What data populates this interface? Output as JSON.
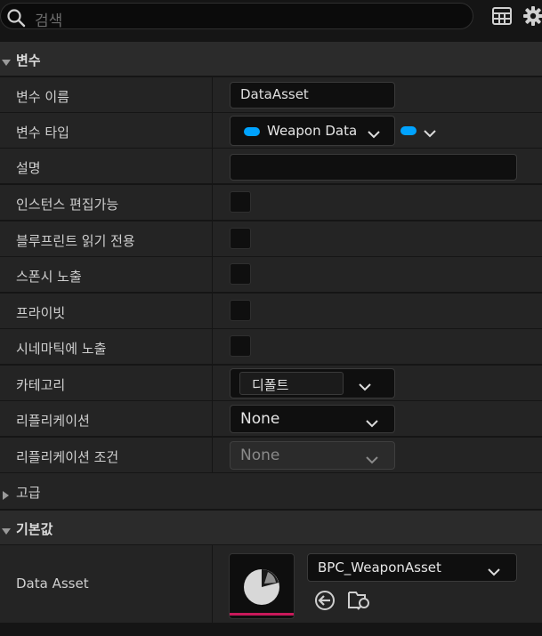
{
  "search": {
    "placeholder": "검색"
  },
  "sections": {
    "variable": {
      "title": "변수"
    },
    "advanced": {
      "title": "고급"
    },
    "default_value": {
      "title": "기본값"
    }
  },
  "rows": {
    "var_name": {
      "label": "변수 이름",
      "value": "DataAsset"
    },
    "var_type": {
      "label": "변수 타입",
      "value": "Weapon Data A",
      "pill_color": "#00a3ff"
    },
    "description": {
      "label": "설명",
      "value": ""
    },
    "instance_editable": {
      "label": "인스턴스 편집가능",
      "checked": false
    },
    "bp_readonly": {
      "label": "블루프린트 읽기 전용",
      "checked": false
    },
    "expose_spawn": {
      "label": "스폰시 노출",
      "checked": false
    },
    "private": {
      "label": "프라이빗",
      "checked": false
    },
    "expose_cinematics": {
      "label": "시네마틱에 노출",
      "checked": false
    },
    "category": {
      "label": "카테고리",
      "value": "디폴트"
    },
    "replication": {
      "label": "리플리케이션",
      "value": "None"
    },
    "replication_condition": {
      "label": "리플리케이션 조건",
      "value": "None"
    }
  },
  "default": {
    "label": "Data Asset",
    "asset": "BPC_WeaponAsset",
    "accent_color": "#c8195a"
  }
}
